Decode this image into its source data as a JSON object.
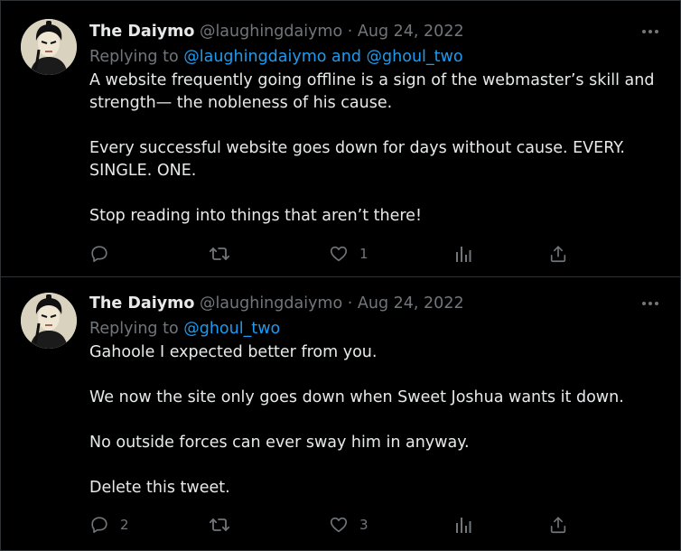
{
  "colors": {
    "background": "#000000",
    "text": "#e7e9ea",
    "muted": "#71767b",
    "link": "#1d9bf0",
    "divider": "#2f3336"
  },
  "icons": {
    "more": "more-dots-icon",
    "reply": "reply-bubble-icon",
    "retweet": "retweet-icon",
    "like": "heart-icon",
    "views": "bar-chart-icon",
    "share": "share-upload-icon"
  },
  "tweets": [
    {
      "display_name": "The Daiymo",
      "handle": "@laughingdaiymo",
      "separator": "·",
      "date": "Aug 24, 2022",
      "replying_to_label": "Replying to ",
      "mention_1": "@laughingdaiymo",
      "mention_join": " and ",
      "mention_2": "@ghoul_two",
      "paragraphs": [
        "A website frequently going offline is a sign of the webmaster’s skill and strength— the nobleness of his cause.",
        "Every successful website goes down for days without cause. EVERY. SINGLE. ONE.",
        "Stop reading into things that aren’t there!"
      ],
      "reply_count": "",
      "retweet_count": "",
      "like_count": "1"
    },
    {
      "display_name": "The Daiymo",
      "handle": "@laughingdaiymo",
      "separator": "·",
      "date": "Aug 24, 2022",
      "replying_to_label": "Replying to ",
      "mention_1": "@ghoul_two",
      "paragraphs": [
        "Gahoole I expected better from you.",
        "We now the site only goes down when Sweet Joshua wants it down.",
        "No outside forces can ever sway him in anyway.",
        "Delete this tweet."
      ],
      "reply_count": "2",
      "retweet_count": "",
      "like_count": "3"
    }
  ]
}
